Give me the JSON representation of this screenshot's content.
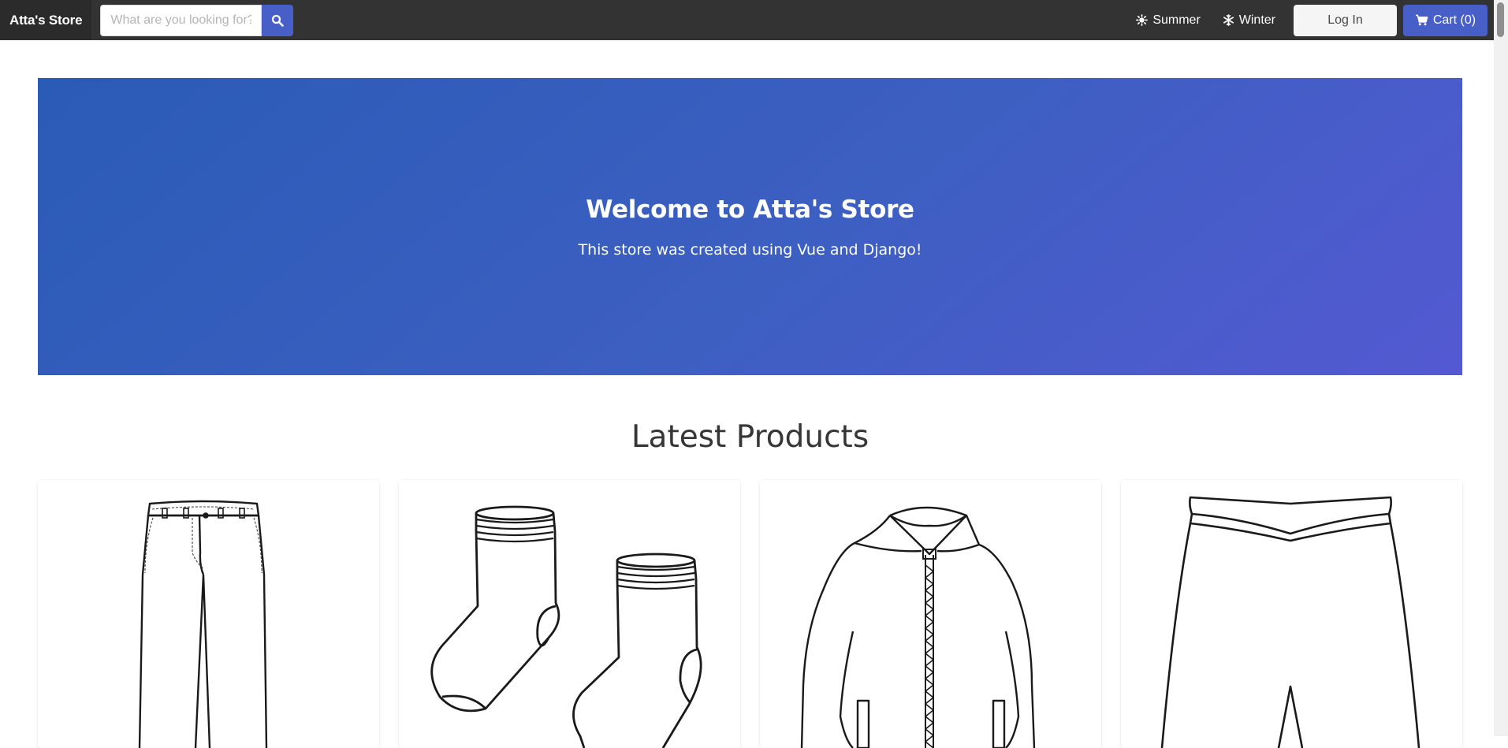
{
  "navbar": {
    "brand": "Atta's Store",
    "search_placeholder": "What are you looking for?",
    "menu": [
      {
        "label": "Summer",
        "icon": "sun-icon"
      },
      {
        "label": "Winter",
        "icon": "snowflake-icon"
      }
    ],
    "login_label": "Log In",
    "cart_label": "Cart (0)"
  },
  "hero": {
    "title": "Welcome to Atta's Store",
    "subtitle": "This store was created using Vue and Django!"
  },
  "products_section": {
    "title": "Latest Products",
    "items": [
      {
        "image": "pants"
      },
      {
        "image": "socks"
      },
      {
        "image": "hoodie jacket"
      },
      {
        "image": "sweatpants"
      }
    ]
  },
  "colors": {
    "navbar": "#333333",
    "primary": "#485fc7",
    "hero_start": "#2a5bb6",
    "hero_end": "#5459d2"
  }
}
